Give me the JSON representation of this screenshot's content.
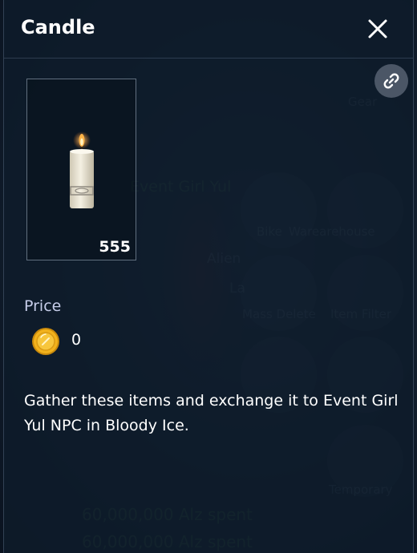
{
  "dialog": {
    "title": "Candle",
    "item": {
      "icon": "candle-icon",
      "count": "555"
    },
    "price": {
      "label": "Price",
      "currency_icon": "gold-coin-icon",
      "value": "0"
    },
    "description": "Gather these items and exchange it to Event Girl Yul NPC in Bloody Ice.",
    "close_icon": "close-icon",
    "link_icon": "link-icon"
  },
  "background": {
    "npc_name": "Event Girl Yul",
    "labels": [
      "Gear",
      "Bike",
      "Warearehouse",
      "Alien",
      "La",
      "Mass Delete",
      "Item Filter",
      "Temporary"
    ],
    "spent_lines": [
      "60,000,000 Alz spent",
      "60,000,000 Alz spent"
    ]
  },
  "colors": {
    "panel_bg": "#0e1b2b",
    "title_text": "#ffffff",
    "price_label": "#c6cde9",
    "coin_gold": "#f2b21c"
  }
}
